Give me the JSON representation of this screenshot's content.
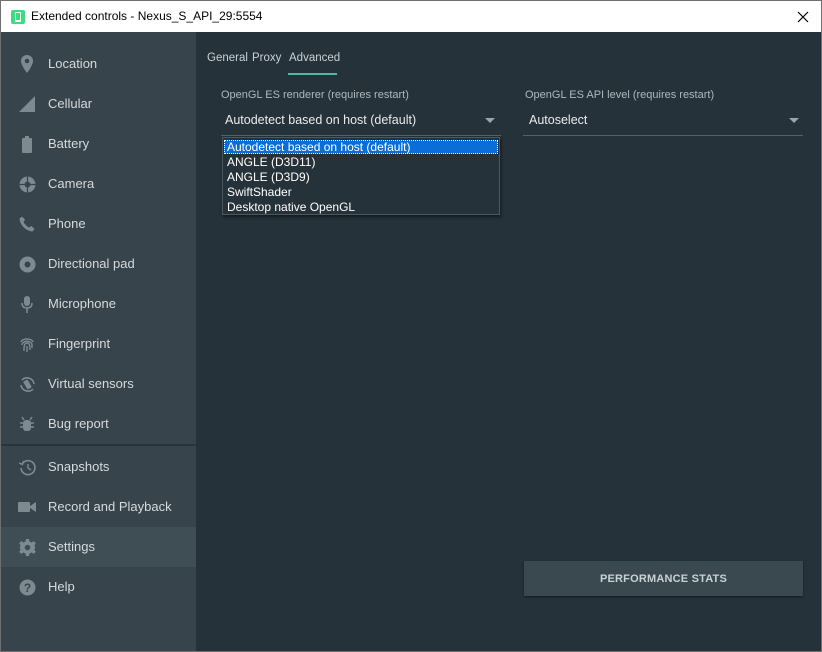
{
  "window": {
    "title": "Extended controls - Nexus_S_API_29:5554",
    "close_icon": "close-icon",
    "app_icon": "android-emulator-icon"
  },
  "sidebar": {
    "items": [
      {
        "label": "Location",
        "icon": "location-pin-icon"
      },
      {
        "label": "Cellular",
        "icon": "signal-icon"
      },
      {
        "label": "Battery",
        "icon": "battery-icon"
      },
      {
        "label": "Camera",
        "icon": "camera-aperture-icon"
      },
      {
        "label": "Phone",
        "icon": "phone-icon"
      },
      {
        "label": "Directional pad",
        "icon": "dpad-icon"
      },
      {
        "label": "Microphone",
        "icon": "microphone-icon"
      },
      {
        "label": "Fingerprint",
        "icon": "fingerprint-icon"
      },
      {
        "label": "Virtual sensors",
        "icon": "rotation-icon"
      },
      {
        "label": "Bug report",
        "icon": "bug-icon"
      },
      {
        "label": "Snapshots",
        "icon": "history-icon"
      },
      {
        "label": "Record and Playback",
        "icon": "video-camera-icon"
      },
      {
        "label": "Settings",
        "icon": "gear-icon"
      },
      {
        "label": "Help",
        "icon": "help-icon"
      }
    ],
    "active": "Settings"
  },
  "tabs": [
    {
      "label": "General"
    },
    {
      "label": "Proxy"
    },
    {
      "label": "Advanced"
    }
  ],
  "active_tab": "Advanced",
  "renderer": {
    "label": "OpenGL ES renderer (requires restart)",
    "value": "Autodetect based on host (default)",
    "options": [
      "Autodetect based on host (default)",
      "ANGLE (D3D11)",
      "ANGLE (D3D9)",
      "SwiftShader",
      "Desktop native OpenGL"
    ],
    "highlighted": "Autodetect based on host (default)"
  },
  "api_level": {
    "label": "OpenGL ES API level (requires restart)",
    "value": "Autoselect"
  },
  "perf_button": {
    "label": "PERFORMANCE STATS"
  },
  "colors": {
    "sidebar_bg": "#37444c",
    "main_bg": "#25323a",
    "accent": "#4cb8a8",
    "selection": "#0a6ed9"
  }
}
